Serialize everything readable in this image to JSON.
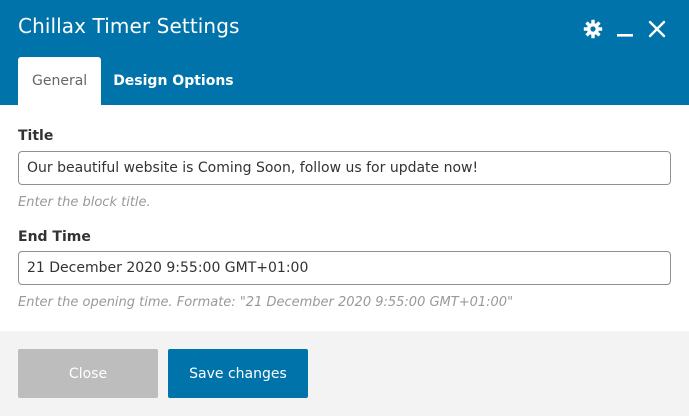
{
  "window": {
    "title": "Chillax Timer Settings",
    "accent_color": "#0073aa",
    "icons": [
      "gear-icon",
      "minimize-icon",
      "close-icon"
    ]
  },
  "tabs": [
    {
      "label": "General",
      "active": true
    },
    {
      "label": "Design Options",
      "active": false
    }
  ],
  "fields": {
    "title": {
      "label": "Title",
      "value": "Our beautiful website is Coming Soon, follow us for update now!",
      "help": "Enter the block title."
    },
    "end_time": {
      "label": "End Time",
      "value": "21 December 2020 9:55:00 GMT+01:00",
      "help": "Enter the opening time. Formate: \"21 December 2020 9:55:00 GMT+01:00\""
    }
  },
  "footer": {
    "close_label": "Close",
    "save_label": "Save changes",
    "close_color": "#bdbdbd",
    "save_color": "#0073aa"
  }
}
